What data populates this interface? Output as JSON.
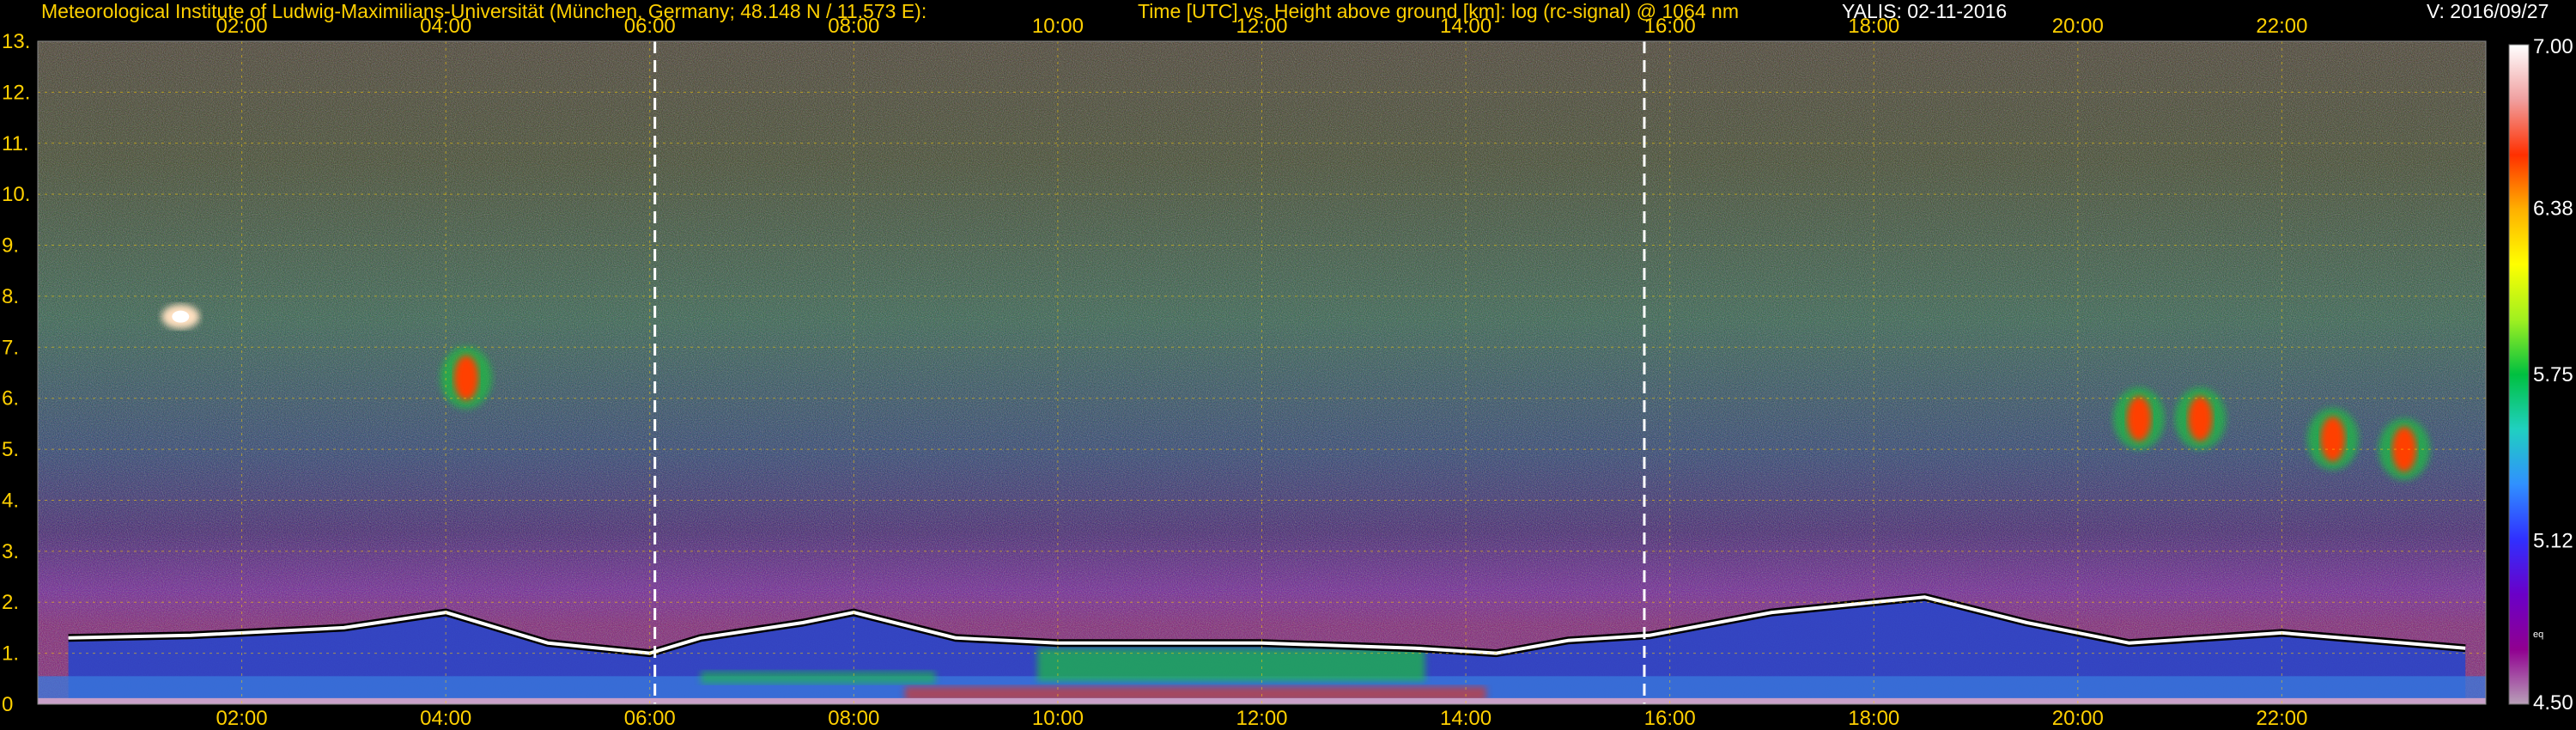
{
  "header": {
    "institute": "Meteorological Institute of Ludwig-Maximilians-Universität (München, Germany; 48.148 N / 11.573 E):",
    "plot_title": "Time [UTC] vs. Height above ground [km]: log (rc-signal) @ 1064 nm",
    "instrument_date": "YALIS: 02-11-2016",
    "version": "V: 2016/09/27"
  },
  "chart_data": {
    "type": "heatmap",
    "title": "Time [UTC] vs. Height above ground [km]: log (rc-signal) @ 1064 nm",
    "xlabel": "",
    "ylabel": "",
    "x_ticks": [
      "02:00",
      "04:00",
      "06:00",
      "08:00",
      "10:00",
      "12:00",
      "14:00",
      "16:00",
      "18:00",
      "20:00",
      "22:00"
    ],
    "x_tick_hours": [
      2,
      4,
      6,
      8,
      10,
      12,
      14,
      16,
      18,
      20,
      22
    ],
    "xlim_hours": [
      0,
      24
    ],
    "y_ticks": [
      "0",
      "1.",
      "2.",
      "3.",
      "4.",
      "5.",
      "6.",
      "7.",
      "8.",
      "9.",
      "10.",
      "11.",
      "12.",
      "13."
    ],
    "y_tick_values": [
      0,
      1,
      2,
      3,
      4,
      5,
      6,
      7,
      8,
      9,
      10,
      11,
      12,
      13
    ],
    "ylim_km": [
      0,
      13
    ],
    "grid": true,
    "marker_lines_hours": [
      6.05,
      15.75
    ],
    "colorbar": {
      "labels": [
        "7.00",
        "6.38",
        "5.75",
        "5.12",
        "4.50"
      ],
      "values": [
        7.0,
        6.38,
        5.75,
        5.12,
        4.5
      ],
      "min": 4.5,
      "max": 7.0,
      "small_label": "eq",
      "colors": [
        "#b8a0b8",
        "#900090",
        "#6a00c8",
        "#3030ff",
        "#3090ff",
        "#20d0c0",
        "#00c040",
        "#a0f020",
        "#ffff00",
        "#ffb000",
        "#ff3000",
        "#f0a0a0",
        "#ffffff"
      ]
    },
    "features": {
      "boundary_layer_top_km": [
        [
          0.3,
          1.3
        ],
        [
          1.5,
          1.35
        ],
        [
          3.0,
          1.5
        ],
        [
          4.0,
          1.8
        ],
        [
          5.0,
          1.2
        ],
        [
          6.0,
          1.0
        ],
        [
          6.5,
          1.3
        ],
        [
          7.5,
          1.6
        ],
        [
          8.0,
          1.8
        ],
        [
          9.0,
          1.3
        ],
        [
          10.0,
          1.2
        ],
        [
          12.0,
          1.2
        ],
        [
          13.5,
          1.1
        ],
        [
          14.3,
          1.0
        ],
        [
          15.0,
          1.25
        ],
        [
          15.8,
          1.35
        ],
        [
          17.0,
          1.8
        ],
        [
          18.5,
          2.1
        ],
        [
          19.5,
          1.6
        ],
        [
          20.5,
          1.2
        ],
        [
          22.0,
          1.4
        ],
        [
          23.8,
          1.1
        ]
      ],
      "clouds": [
        {
          "t": 1.4,
          "km": 7.6,
          "kind": "white"
        },
        {
          "t": 4.2,
          "km": 6.4,
          "kind": "orange"
        },
        {
          "t": 20.6,
          "km": 5.6,
          "kind": "orange"
        },
        {
          "t": 21.2,
          "km": 5.6,
          "kind": "orange"
        },
        {
          "t": 22.5,
          "km": 5.2,
          "kind": "orange"
        },
        {
          "t": 23.2,
          "km": 5.0,
          "kind": "orange"
        }
      ]
    }
  }
}
